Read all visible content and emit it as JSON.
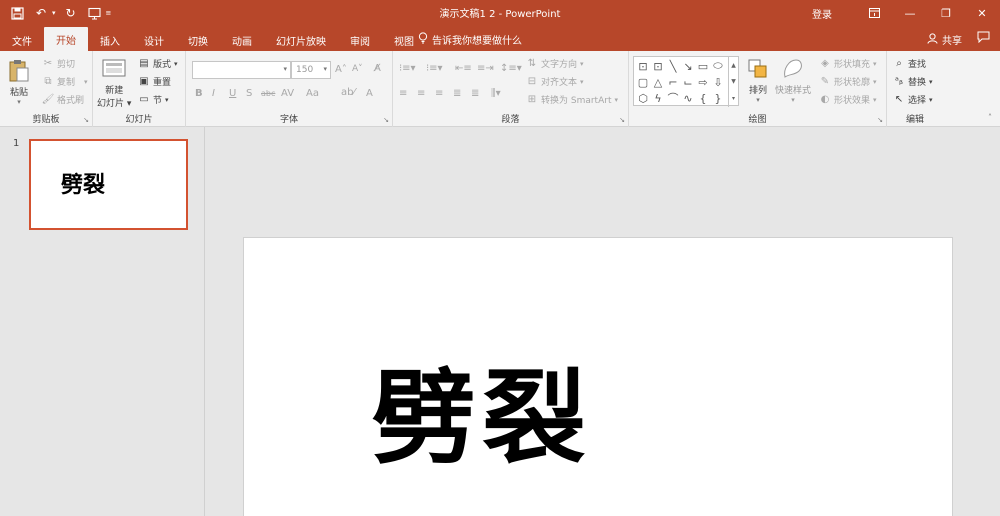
{
  "window": {
    "document_title": "演示文稿1 2 - PowerPoint",
    "sign_in": "登录"
  },
  "tabs": [
    "文件",
    "开始",
    "插入",
    "设计",
    "切换",
    "动画",
    "幻灯片放映",
    "审阅",
    "视图"
  ],
  "active_tab": "开始",
  "tell_me": "告诉我你想要做什么",
  "share": "共享",
  "clipboard": {
    "paste": "粘贴",
    "cut": "剪切",
    "copy": "复制",
    "format_painter": "格式刷",
    "label": "剪贴板"
  },
  "slides_group": {
    "new_slide_line1": "新建",
    "new_slide_line2": "幻灯片",
    "layout": "版式",
    "reset": "重置",
    "section": "节",
    "label": "幻灯片"
  },
  "font": {
    "font_name": "",
    "font_size": "150",
    "label": "字体",
    "bold": "B",
    "italic": "I",
    "underline": "U",
    "strike": "S",
    "spacing": "abc",
    "case": "Aa",
    "grow": "A",
    "shrink": "A",
    "color": "A"
  },
  "paragraph": {
    "text_direction": "文字方向",
    "align_text": "对齐文本",
    "smartart": "转换为 SmartArt",
    "label": "段落"
  },
  "drawing": {
    "arrange": "排列",
    "quick_styles": "快速样式",
    "shape_fill": "形状填充",
    "shape_outline": "形状轮廓",
    "shape_effects": "形状效果",
    "label": "绘图"
  },
  "editing": {
    "find": "查找",
    "replace": "替换",
    "select": "选择",
    "label": "编辑"
  },
  "slides": [
    {
      "number": "1",
      "text": "劈裂"
    }
  ],
  "current_slide": {
    "text": "劈裂"
  }
}
